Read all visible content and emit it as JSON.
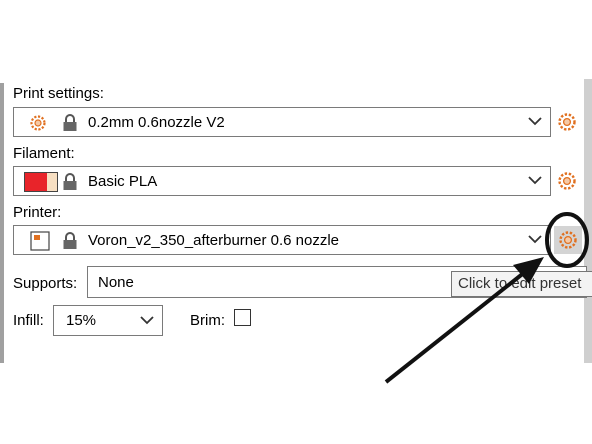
{
  "print_settings": {
    "label": "Print settings:",
    "value": "0.2mm 0.6nozzle V2",
    "icon": "gear-icon"
  },
  "filament": {
    "label": "Filament:",
    "value": "Basic PLA",
    "swatch_color": "#e8242a",
    "icon": "filament-swatch-icon"
  },
  "printer": {
    "label": "Printer:",
    "value": "Voron_v2_350_afterburner 0.6 nozzle",
    "icon": "printer-icon"
  },
  "supports": {
    "label": "Supports:",
    "value": "None"
  },
  "infill": {
    "label": "Infill:",
    "value": "15%"
  },
  "brim": {
    "label": "Brim:",
    "checked": false
  },
  "tooltip": {
    "text": "Click to edit preset"
  },
  "colors": {
    "gear_accent": "#e07020",
    "annotation": "#111111"
  }
}
